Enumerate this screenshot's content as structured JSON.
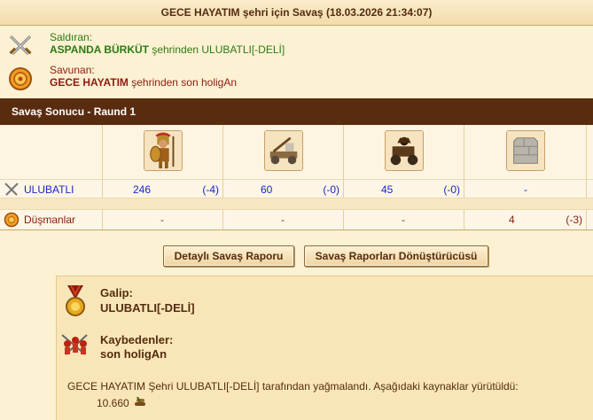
{
  "title": "GECE HAYATIM şehri için Savaş (18.03.2026 21:34:07)",
  "attacker": {
    "label": "Saldıran:",
    "name": "ASPANDA BÜRKÜT",
    "suffix": " şehrinden ULUBATLI[-DELİ]"
  },
  "defender": {
    "label": "Savunan:",
    "name": "GECE HAYATIM",
    "suffix": " şehrinden son holigAn"
  },
  "round_label": "Savaş Sonucu - Raund 1",
  "units": [
    "hoplite-icon",
    "catapult-icon",
    "cart-icon",
    "wall-icon"
  ],
  "rows": {
    "attacker": {
      "label": "ULUBATLI",
      "cells": [
        {
          "count": "246",
          "loss": "(-4)"
        },
        {
          "count": "60",
          "loss": "(-0)"
        },
        {
          "count": "45",
          "loss": "(-0)"
        },
        {
          "count": "-",
          "loss": ""
        }
      ]
    },
    "enemy": {
      "label": "Düşmanlar",
      "cells": [
        {
          "count": "-",
          "loss": ""
        },
        {
          "count": "-",
          "loss": ""
        },
        {
          "count": "-",
          "loss": ""
        },
        {
          "count": "4",
          "loss": "(-3)"
        }
      ]
    }
  },
  "buttons": {
    "detail": "Detaylı Savaş Raporu",
    "converter": "Savaş Raporları Dönüştürücüsü"
  },
  "result": {
    "winner_label": "Galip:",
    "winner_name": "ULUBATLI[-DELİ]",
    "loser_label": "Kaybedenler:",
    "loser_name": "son holigAn",
    "loot_text": "GECE HAYATIM Şehri ULUBATLI[-DELİ] tarafından yağmalandı. Aşağıdaki kaynaklar yürütüldü:",
    "loot_amount": "10.660"
  },
  "colors": {
    "header_bar": "#5a2c0f",
    "attacker_text": "#2b7b13",
    "defender_text": "#8b1c10",
    "unit_count_blue": "#1a25c9"
  }
}
